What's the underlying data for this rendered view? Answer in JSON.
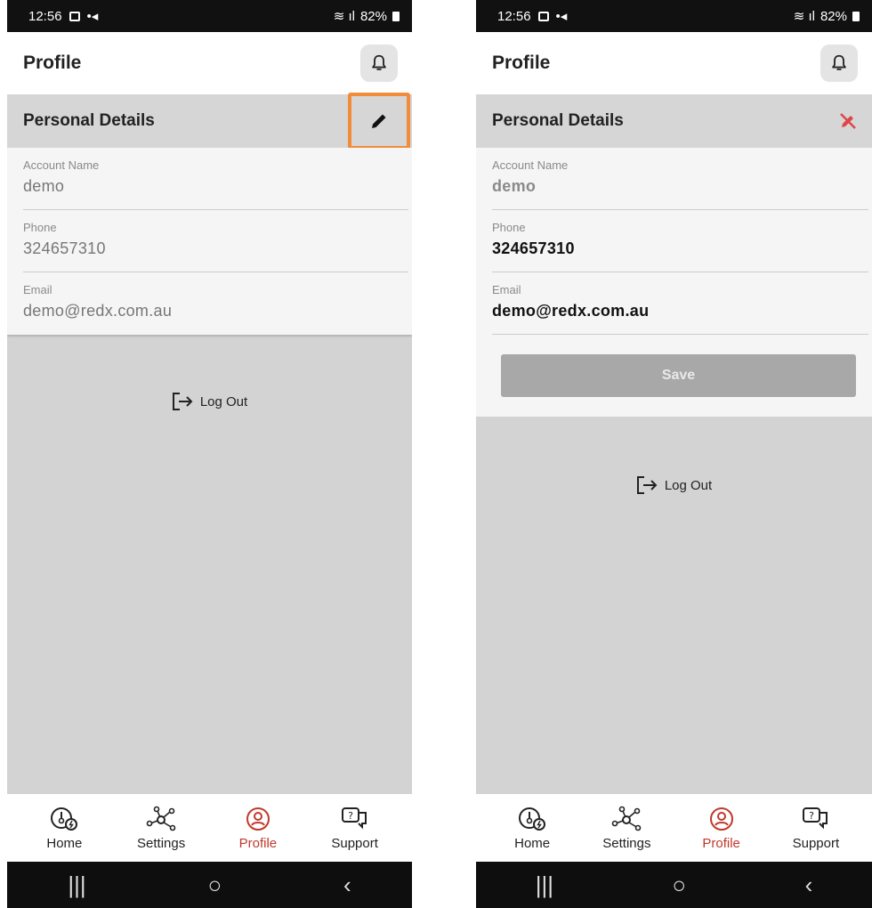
{
  "left": {
    "status": {
      "time": "12:56",
      "battery": "82%"
    },
    "header": {
      "title": "Profile"
    },
    "details": {
      "title": "Personal Details",
      "fields": [
        {
          "label": "Account Name",
          "value": "demo"
        },
        {
          "label": "Phone",
          "value": "324657310"
        },
        {
          "label": "Email",
          "value": "demo@redx.com.au"
        }
      ]
    },
    "logout_label": "Log Out",
    "nav": [
      {
        "label": "Home",
        "icon": "home-gauge-icon"
      },
      {
        "label": "Settings",
        "icon": "network-settings-icon"
      },
      {
        "label": "Profile",
        "icon": "profile-icon",
        "active": true
      },
      {
        "label": "Support",
        "icon": "support-chat-icon"
      }
    ]
  },
  "right": {
    "status": {
      "time": "12:56",
      "battery": "82%"
    },
    "header": {
      "title": "Profile"
    },
    "details": {
      "title": "Personal Details",
      "fields": [
        {
          "label": "Account Name",
          "value": "demo"
        },
        {
          "label": "Phone",
          "value": "324657310"
        },
        {
          "label": "Email",
          "value": "demo@redx.com.au"
        }
      ],
      "save_label": "Save"
    },
    "logout_label": "Log Out",
    "nav": [
      {
        "label": "Home",
        "icon": "home-gauge-icon"
      },
      {
        "label": "Settings",
        "icon": "network-settings-icon"
      },
      {
        "label": "Profile",
        "icon": "profile-icon",
        "active": true
      },
      {
        "label": "Support",
        "icon": "support-chat-icon"
      }
    ]
  },
  "colors": {
    "accent_active": "#c0392b",
    "highlight_box": "#f28c3a",
    "cancel_edit": "#e04545"
  }
}
